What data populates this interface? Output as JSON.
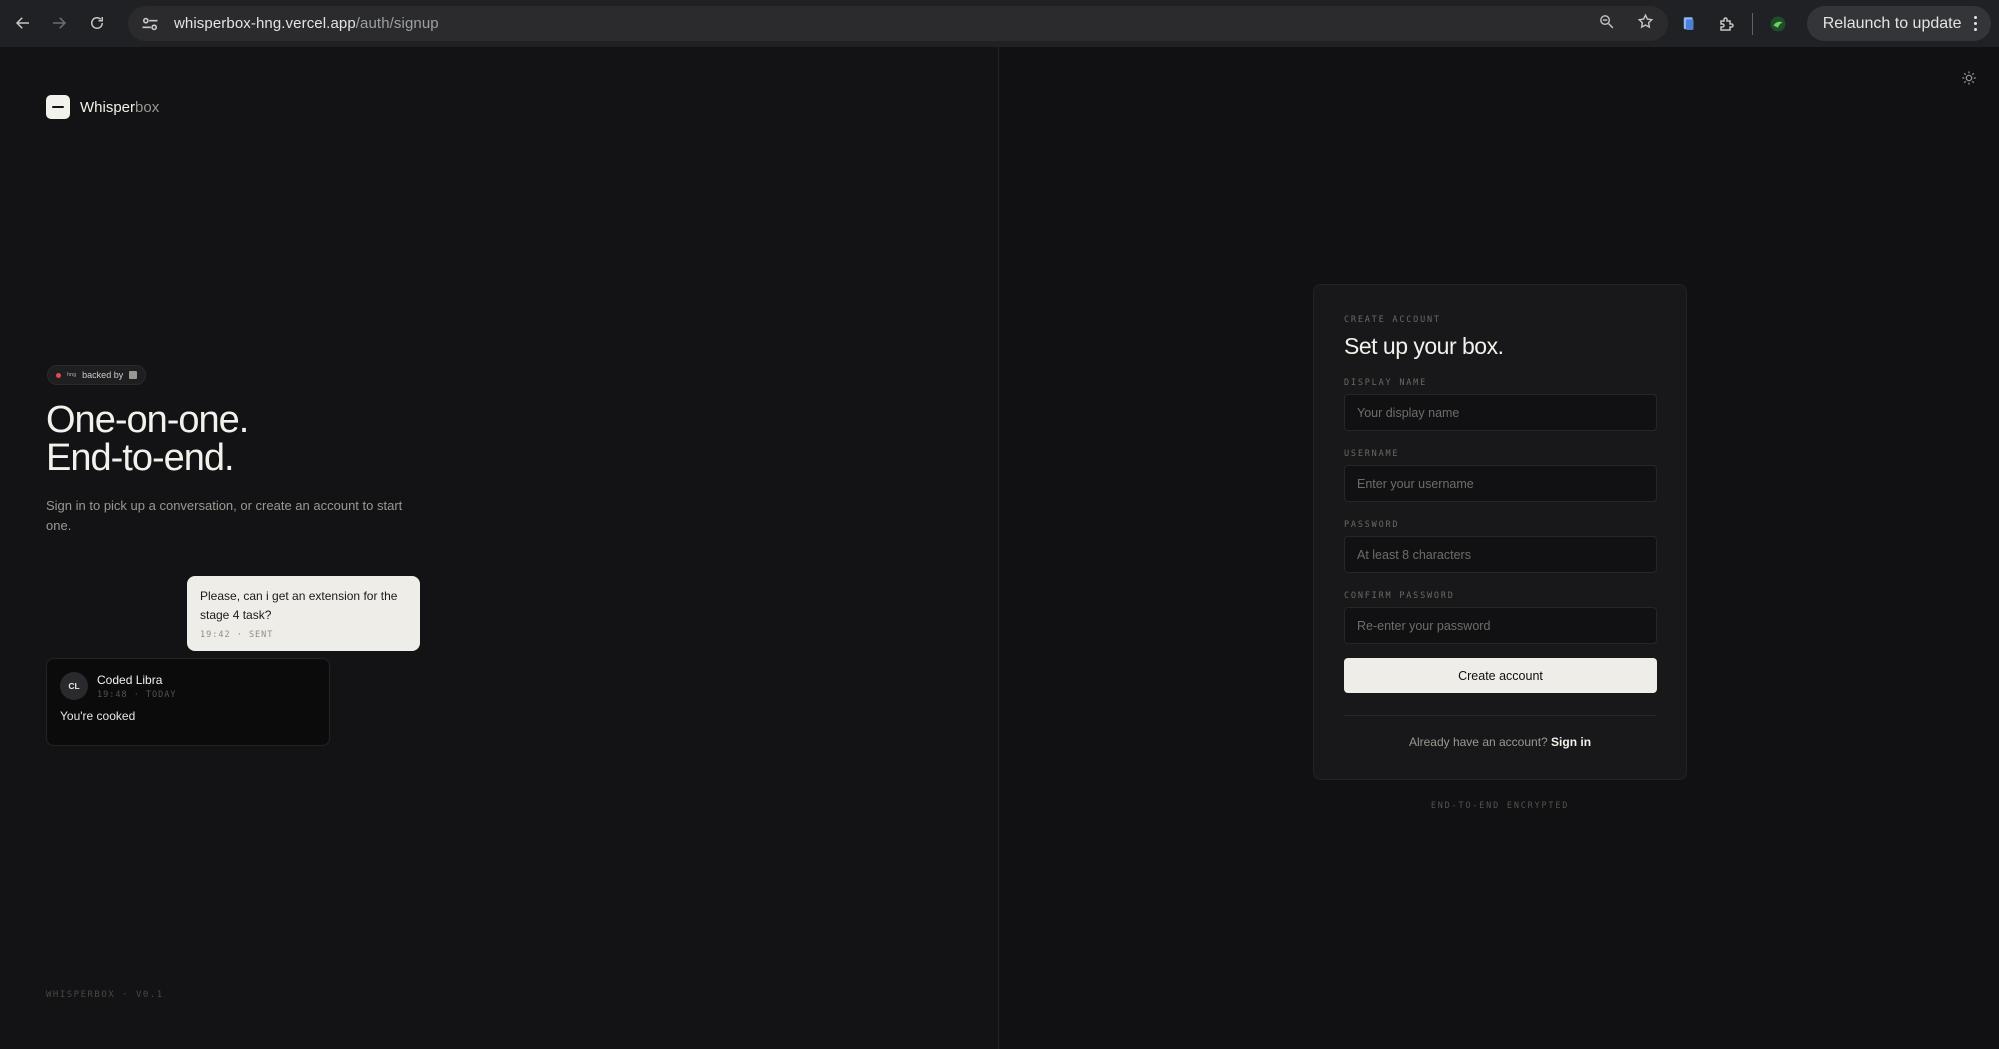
{
  "browser": {
    "url_host": "whisperbox-hng.vercel.app",
    "url_path": "/auth/signup",
    "relaunch_label": "Relaunch to update"
  },
  "brand": {
    "name_strong": "Whisper",
    "name_dim": "box"
  },
  "badge": {
    "tag": "hng",
    "text": "backed by"
  },
  "hero": {
    "line1": "One-on-one.",
    "line2": "End-to-end.",
    "subtitle": "Sign in to pick up a conversation, or create an account to start one."
  },
  "sent_message": {
    "text": "Please, can i get an extension for the stage 4 task?",
    "meta": "19:42 · SENT"
  },
  "received_message": {
    "initials": "CL",
    "name": "Coded Libra",
    "meta": "19:48 · TODAY",
    "text": "You're cooked"
  },
  "footer_version": "WHISPERBOX · V0.1",
  "signup": {
    "eyebrow": "CREATE ACCOUNT",
    "title": "Set up your box.",
    "fields": [
      {
        "label": "DISPLAY NAME",
        "placeholder": "Your display name",
        "value": ""
      },
      {
        "label": "USERNAME",
        "placeholder": "Enter your username",
        "value": ""
      },
      {
        "label": "PASSWORD",
        "placeholder": "At least 8 characters",
        "value": ""
      },
      {
        "label": "CONFIRM PASSWORD",
        "placeholder": "Re-enter your password",
        "value": ""
      }
    ],
    "submit_label": "Create account",
    "have_account": "Already have an account?",
    "signin_label": "Sign in",
    "encrypted_note": "END-TO-END ENCRYPTED"
  }
}
